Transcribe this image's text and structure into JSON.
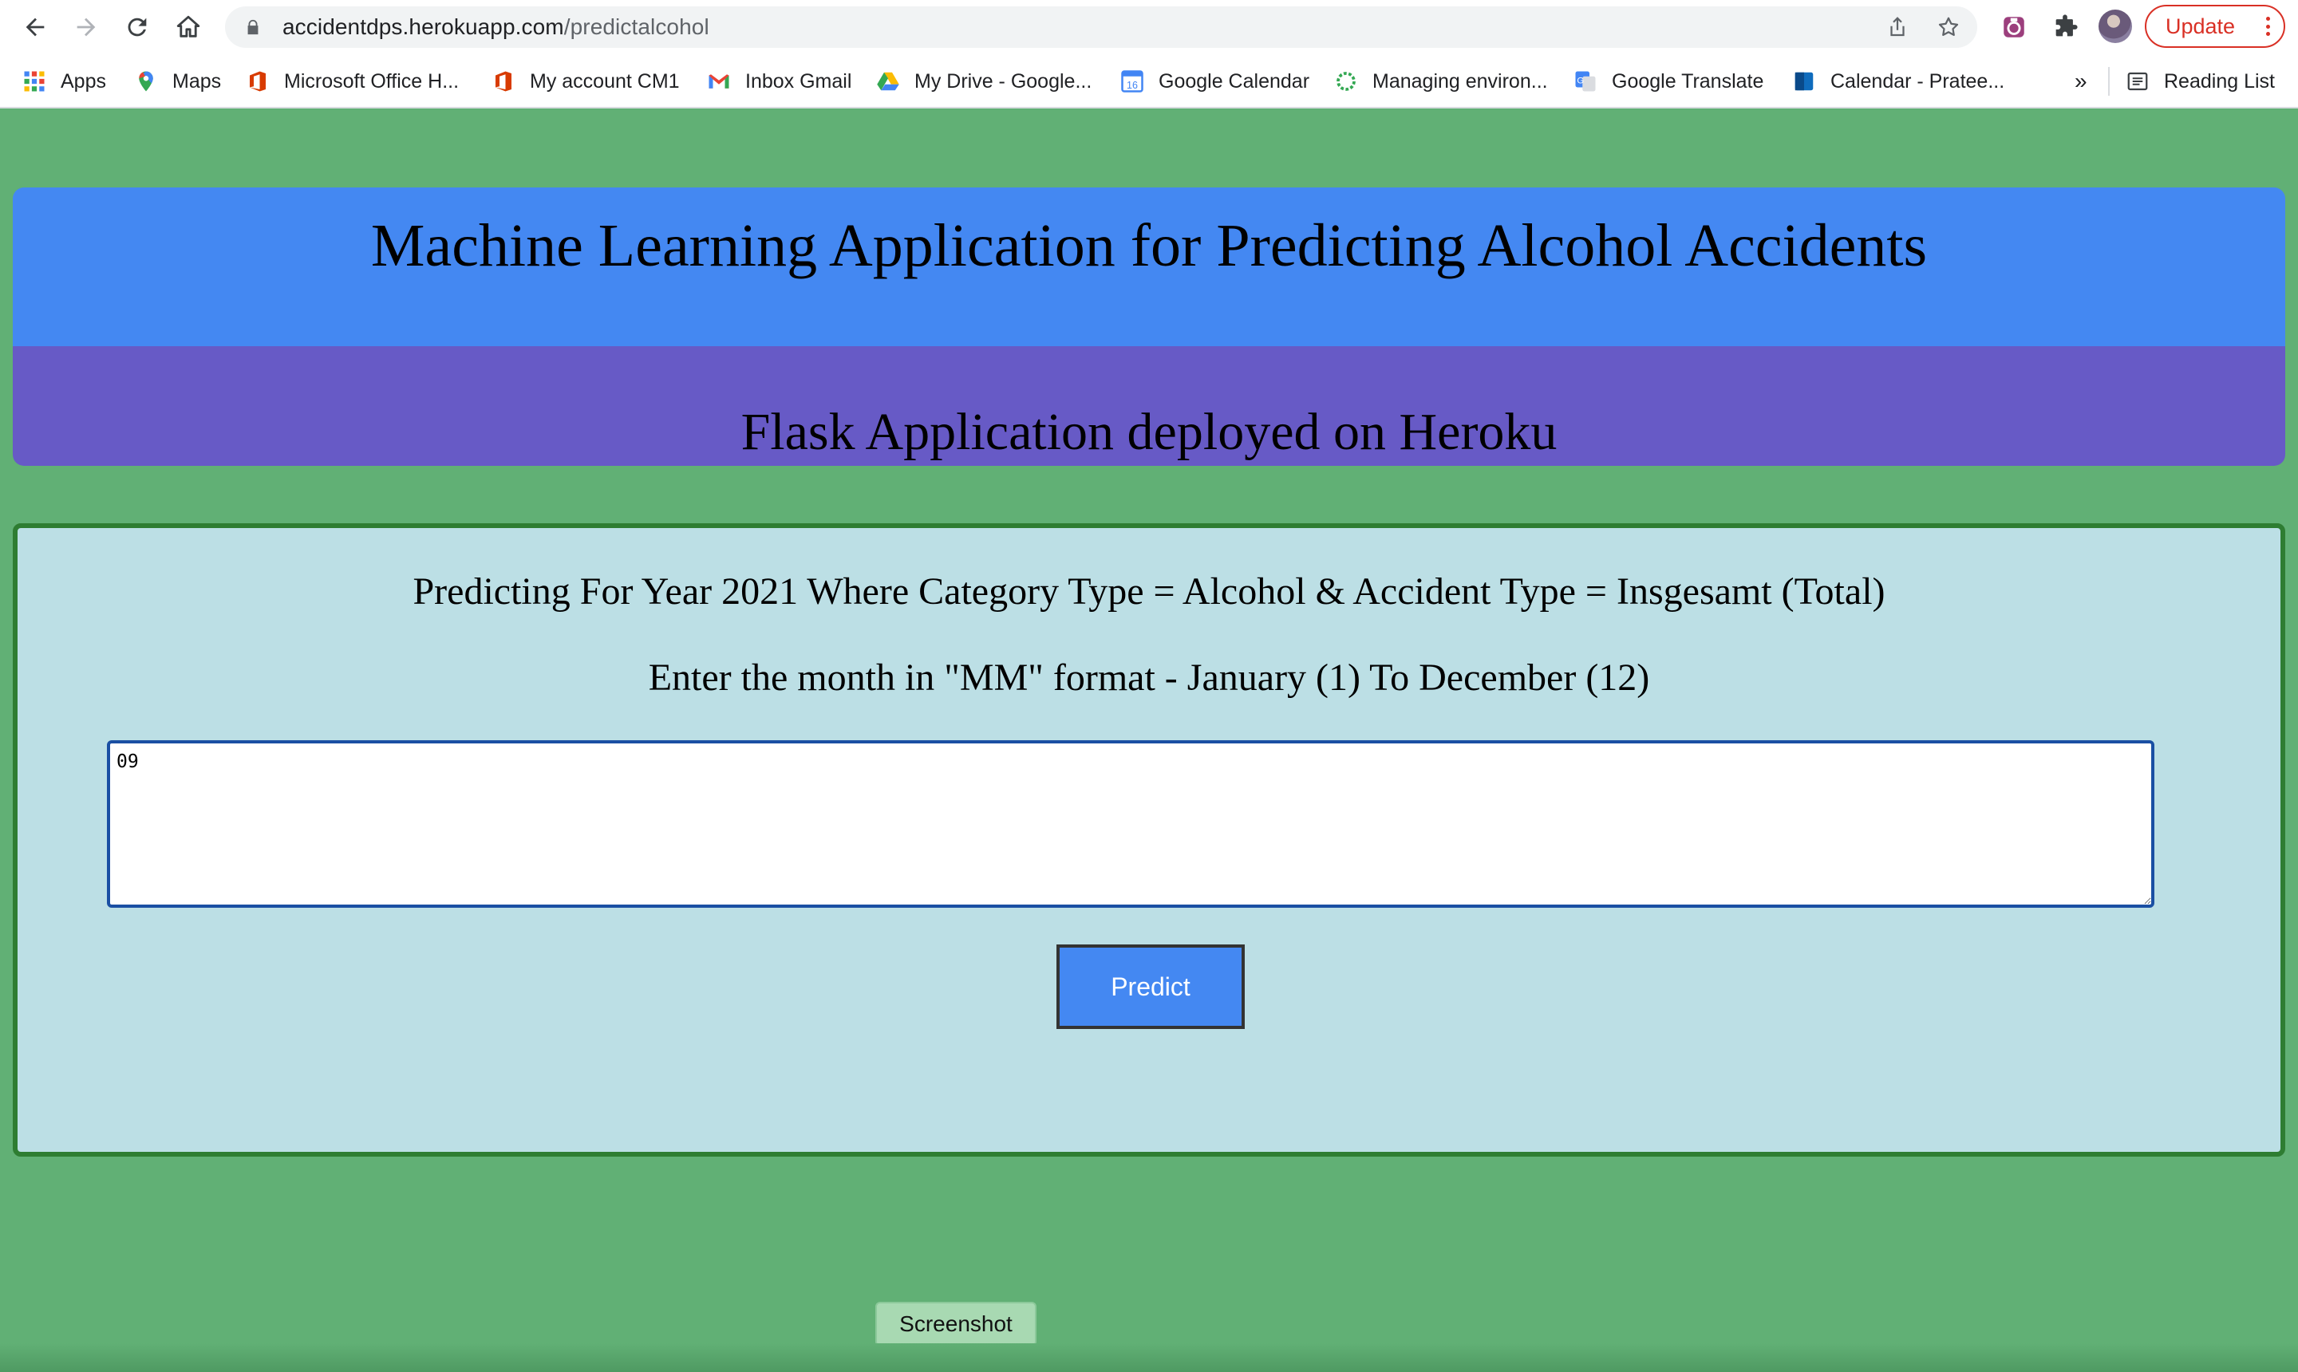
{
  "browser": {
    "url_host": "accidentdps.herokuapp.com",
    "url_path": "/predictalcohol",
    "update_label": "Update",
    "bookmarks": [
      {
        "label": "Apps",
        "icon": "apps-grid-icon"
      },
      {
        "label": "Maps",
        "icon": "maps-pin-icon"
      },
      {
        "label": "Microsoft Office H...",
        "icon": "office-icon"
      },
      {
        "label": "My account CM1",
        "icon": "office-icon"
      },
      {
        "label": "Inbox Gmail",
        "icon": "gmail-icon"
      },
      {
        "label": "My Drive - Google...",
        "icon": "drive-icon"
      },
      {
        "label": "Google Calendar",
        "icon": "calendar-icon"
      },
      {
        "label": "Managing environ...",
        "icon": "spinner-icon"
      },
      {
        "label": "Google Translate",
        "icon": "translate-icon"
      },
      {
        "label": "Calendar - Pratee...",
        "icon": "outlook-calendar-icon"
      }
    ],
    "more_label": "»",
    "reading_list_label": "Reading List"
  },
  "page": {
    "title": "Machine Learning Application for Predicting Alcohol Accidents",
    "subtitle": "Flask Application deployed on Heroku",
    "form": {
      "prediction_text": "Predicting For Year 2021 Where Category Type = Alcohol & Accident Type = Insgesamt (Total)",
      "instruction_text": "Enter the month in \"MM\" format - January (1) To December (12)",
      "month_value": "09",
      "predict_label": "Predict"
    }
  },
  "overlay": {
    "tooltip_label": "Screenshot"
  }
}
